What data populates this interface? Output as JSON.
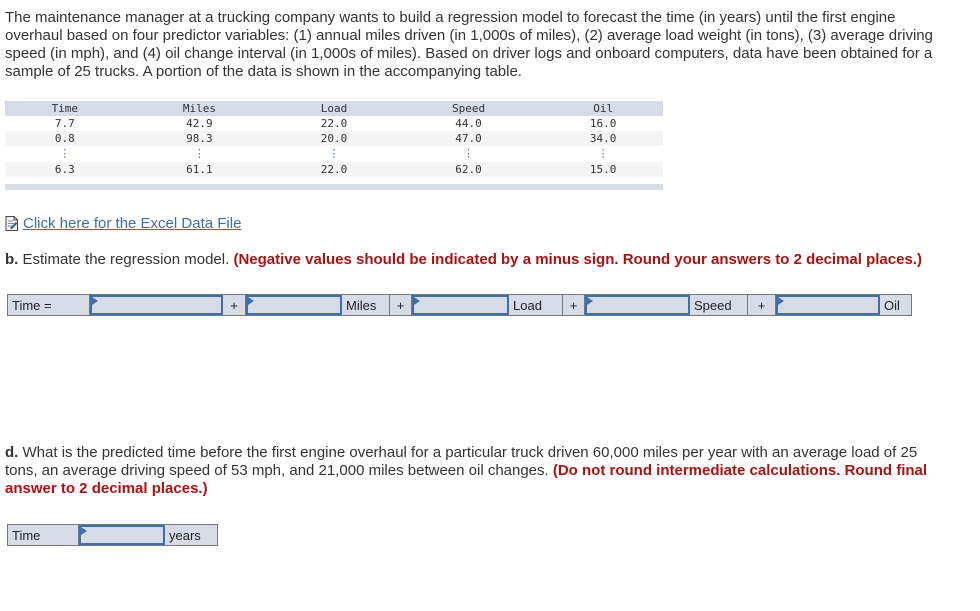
{
  "intro": "The maintenance manager at a trucking company wants to build a regression model to forecast the time (in years) until the first engine overhaul based on four predictor variables: (1) annual miles driven (in 1,000s of miles), (2) average load weight (in tons), (3) average driving speed (in mph), and (4) oil change interval (in 1,000s of miles). Based on driver logs and onboard computers, data have been obtained for a sample of 25 trucks. A portion of the data is shown in the accompanying table.",
  "table": {
    "headers": [
      "Time",
      "Miles",
      "Load",
      "Speed",
      "Oil"
    ],
    "rows": [
      [
        "7.7",
        "42.9",
        "22.0",
        "44.0",
        "16.0"
      ],
      [
        "0.8",
        "98.3",
        "20.0",
        "47.0",
        "34.0"
      ]
    ],
    "ellipsis": "⋮",
    "last_row": [
      "6.3",
      "61.1",
      "22.0",
      "62.0",
      "15.0"
    ]
  },
  "excel_link": {
    "icon": "document-file-icon",
    "label": "Click here for the Excel Data File"
  },
  "question_b": {
    "letter": "b.",
    "text": " Estimate the regression model. ",
    "note": "(Negative values should be indicated by a minus sign. Round your answers to 2 decimal places.)",
    "equation": {
      "lhs": "Time =",
      "plus": "+",
      "vars": [
        "Miles",
        "Load",
        "Speed",
        "Oil"
      ],
      "inputs": [
        "",
        "",
        "",
        "",
        ""
      ]
    }
  },
  "question_d": {
    "letter": "d.",
    "text": " What is the predicted time before the first engine overhaul for a particular truck driven 60,000 miles per year with an average load of 25 tons, an average driving speed of 53 mph, and 21,000 miles between oil changes. ",
    "note": "(Do not round intermediate calculations. Round final answer to 2 decimal places.)",
    "answer": {
      "label": "Time",
      "value": "",
      "unit": "years"
    }
  },
  "colors": {
    "accent_red": "#b01010",
    "link_blue": "#3a6ea8",
    "input_border": "#3f6fab",
    "cell_bg": "#d6dbe6"
  }
}
